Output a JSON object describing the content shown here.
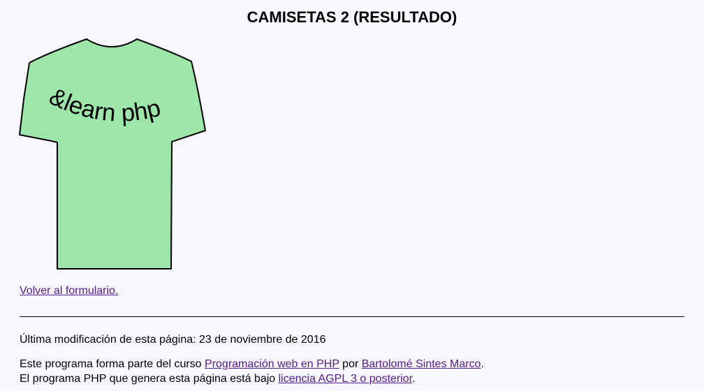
{
  "page": {
    "title": "CAMISETAS 2 (RESULTADO)"
  },
  "shirt": {
    "text": "&learn php",
    "color": "#9de5a8",
    "outline_color": "#000000"
  },
  "links": {
    "back": "Volver al formulario."
  },
  "footer": {
    "modified": "Última modificación de esta página: 23 de noviembre de 2016",
    "line1_prefix": "Este programa forma parte del curso ",
    "course_link": "Programación web en PHP",
    "line1_middle": " por ",
    "author_link": "Bartolomé Sintes Marco",
    "line1_suffix": ".",
    "line2_prefix": "El programa PHP que genera esta página está bajo ",
    "license_link": "licencia AGPL 3 o posterior",
    "line2_suffix": "."
  },
  "colors": {
    "background": "#f7f7fd",
    "link": "#551a8b"
  }
}
